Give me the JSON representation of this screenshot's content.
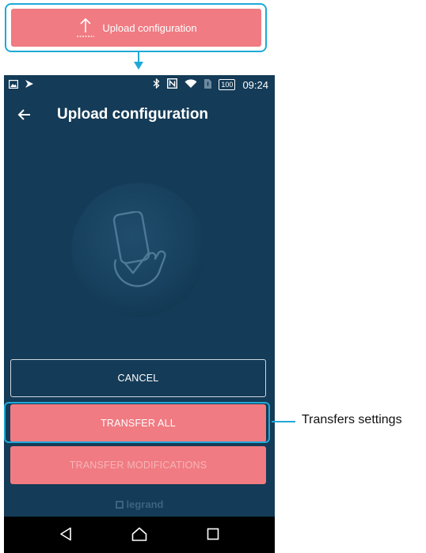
{
  "callout": {
    "icon": "upload-arrow-icon",
    "label": "Upload configuration"
  },
  "status_bar": {
    "left_icons": [
      "image-icon",
      "flag-icon"
    ],
    "right_icons": [
      "bluetooth-icon",
      "nfc-icon",
      "wifi-icon",
      "sim-icon"
    ],
    "battery": "100",
    "time": "09:24"
  },
  "app_bar": {
    "back_icon": "back-arrow-icon",
    "title": "Upload configuration"
  },
  "illustration": {
    "icon": "hand-phone-nfc-icon"
  },
  "buttons": {
    "cancel": "CANCEL",
    "transfer_all": "TRANSFER ALL",
    "transfer_modifications": "TRANSFER MODIFICATIONS"
  },
  "brand": {
    "logo": "legrand"
  },
  "annotation": {
    "label": "Transfers settings"
  },
  "colors": {
    "accent": "#f07b82",
    "background": "#143b57",
    "highlight": "#1fa9d8"
  }
}
